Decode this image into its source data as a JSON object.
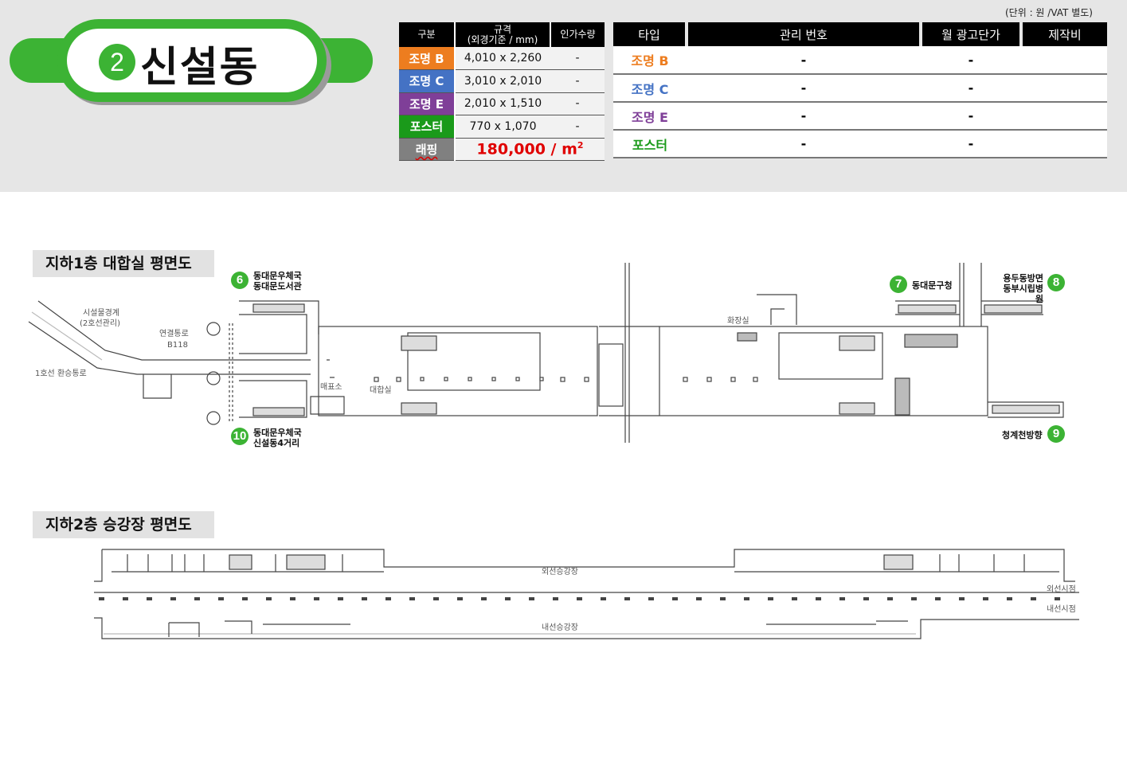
{
  "header": {
    "station_number": "2",
    "station_name": "신설동",
    "unit_note": "(단위 : 원 /VAT 별도)"
  },
  "spec_table": {
    "headers": [
      "구분",
      "규격",
      "(외경기준 / mm)",
      "인가수량"
    ],
    "rows": [
      {
        "type": "조명 B",
        "size": "4,010 x 2,260",
        "qty": "-",
        "color": "#ed7d1f"
      },
      {
        "type": "조명 C",
        "size": "3,010 x 2,010",
        "qty": "-",
        "color": "#4472c4"
      },
      {
        "type": "조명 E",
        "size": "2,010 x 1,510",
        "qty": "-",
        "color": "#7f3f98"
      },
      {
        "type": "포스터",
        "size": "770 x 1,070",
        "qty": "-",
        "color": "#1a9a1a"
      }
    ],
    "wrapping": {
      "label": "래핑",
      "price": "180,000 / m",
      "price_sup": "2",
      "color": "#808080"
    }
  },
  "ad_table": {
    "headers": [
      "타입",
      "관리 번호",
      "월 광고단가",
      "제작비"
    ],
    "rows": [
      {
        "type": "조명 B",
        "mgmt": "-",
        "price": "-",
        "cost": "",
        "color": "#ed7d1f"
      },
      {
        "type": "조명 C",
        "mgmt": "-",
        "price": "-",
        "cost": "",
        "color": "#4472c4"
      },
      {
        "type": "조명 E",
        "mgmt": "-",
        "price": "-",
        "cost": "",
        "color": "#7f3f98"
      },
      {
        "type": "포스터",
        "mgmt": "-",
        "price": "-",
        "cost": "",
        "color": "#1a9a1a"
      }
    ]
  },
  "b1_plan": {
    "label": "지하1층 대합실 평면도",
    "exits": [
      {
        "num": "6",
        "text1": "동대문우체국",
        "text2": "동대문도서관"
      },
      {
        "num": "10",
        "text1": "동대문우체국",
        "text2": "신설동4거리"
      },
      {
        "num": "7",
        "text1": "동대문구청",
        "text2": ""
      },
      {
        "num": "8",
        "text1": "용두동방면",
        "text2": "동부시립병원"
      },
      {
        "num": "9",
        "text1": "청계천방향",
        "text2": ""
      }
    ],
    "texts": {
      "facility_boundary": "시설물경계",
      "boundary_note": "(2호선관리)",
      "corridor": "연결통로",
      "corridor_code": "B118",
      "transfer": "1호선 환승통로",
      "ticket": "매표소",
      "concourse": "대합실",
      "restroom": "화장실"
    }
  },
  "b2_plan": {
    "label": "지하2층 승강장 평면도",
    "texts": {
      "outer_platform": "외선승강장",
      "inner_platform": "내선승강장",
      "outer_track": "외선시점",
      "inner_track": "내선시점"
    }
  }
}
